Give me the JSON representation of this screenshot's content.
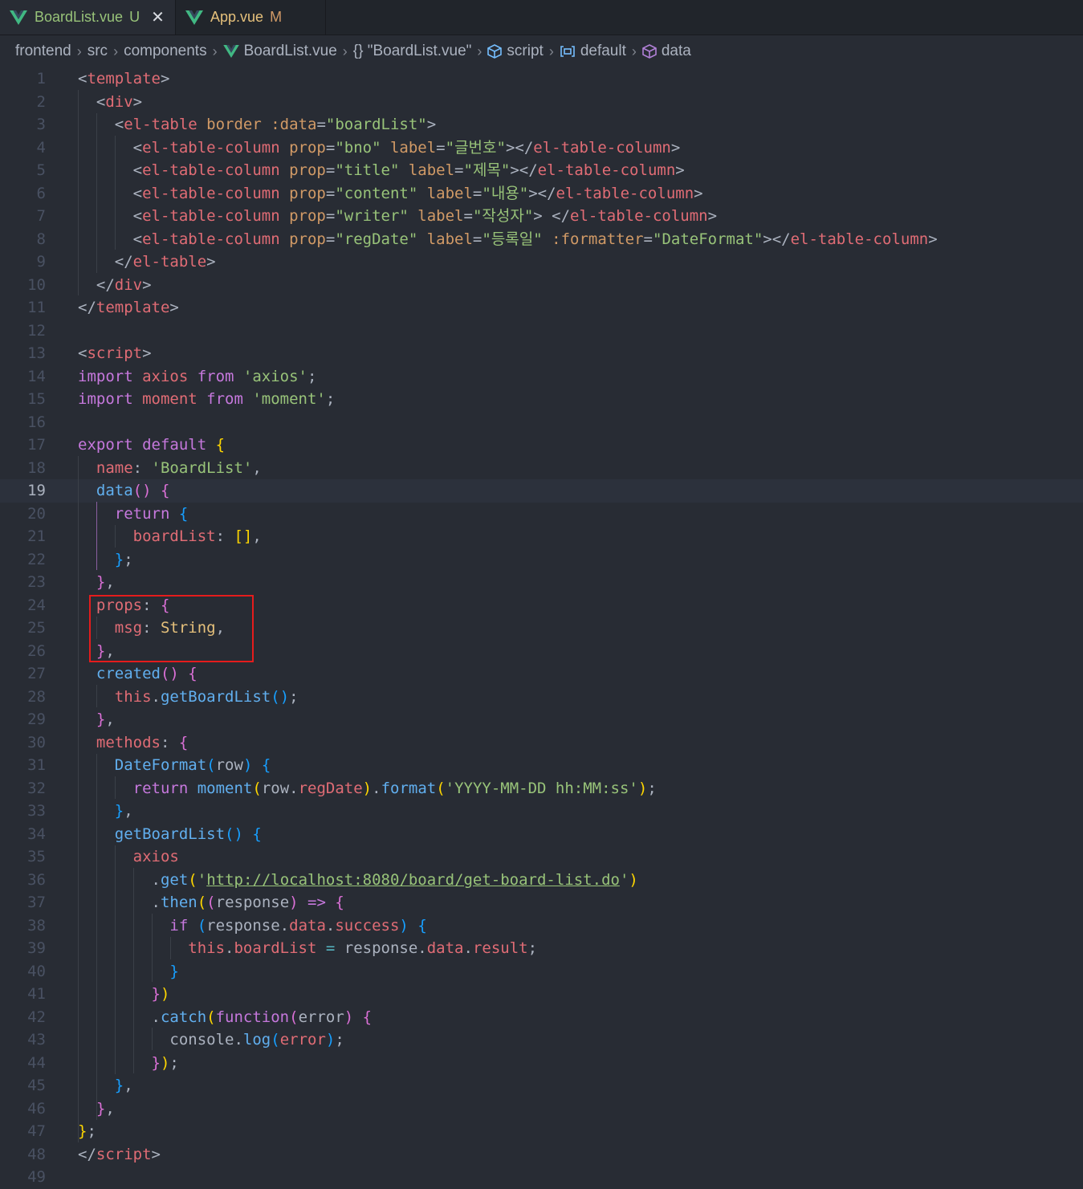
{
  "tabs": [
    {
      "name": "BoardList.vue",
      "status": "U",
      "close": "✕",
      "active": true
    },
    {
      "name": "App.vue",
      "status": "M",
      "active": false
    }
  ],
  "breadcrumb": [
    "frontend",
    "src",
    "components",
    "BoardList.vue",
    "{} \"BoardList.vue\"",
    "script",
    "default",
    "data"
  ],
  "editor": {
    "current_line": 19,
    "lines": [
      [
        [
          "t-punc",
          "<"
        ],
        [
          "t-tag",
          "template"
        ],
        [
          "t-punc",
          ">"
        ]
      ],
      [
        [
          "t-punc",
          "  <"
        ],
        [
          "t-tag",
          "div"
        ],
        [
          "t-punc",
          ">"
        ]
      ],
      [
        [
          "t-punc",
          "    <"
        ],
        [
          "t-tag",
          "el-table"
        ],
        [
          "t-attr",
          " border :data"
        ],
        [
          "t-punc",
          "="
        ],
        [
          "t-str",
          "\"boardList\""
        ],
        [
          "t-punc",
          ">"
        ]
      ],
      [
        [
          "t-punc",
          "      <"
        ],
        [
          "t-tag",
          "el-table-column"
        ],
        [
          "t-attr",
          " prop"
        ],
        [
          "t-punc",
          "="
        ],
        [
          "t-str",
          "\"bno\""
        ],
        [
          "t-attr",
          " label"
        ],
        [
          "t-punc",
          "="
        ],
        [
          "t-str",
          "\"글번호\""
        ],
        [
          "t-punc",
          "></"
        ],
        [
          "t-tag",
          "el-table-column"
        ],
        [
          "t-punc",
          ">"
        ]
      ],
      [
        [
          "t-punc",
          "      <"
        ],
        [
          "t-tag",
          "el-table-column"
        ],
        [
          "t-attr",
          " prop"
        ],
        [
          "t-punc",
          "="
        ],
        [
          "t-str",
          "\"title\""
        ],
        [
          "t-attr",
          " label"
        ],
        [
          "t-punc",
          "="
        ],
        [
          "t-str",
          "\"제목\""
        ],
        [
          "t-punc",
          "></"
        ],
        [
          "t-tag",
          "el-table-column"
        ],
        [
          "t-punc",
          ">"
        ]
      ],
      [
        [
          "t-punc",
          "      <"
        ],
        [
          "t-tag",
          "el-table-column"
        ],
        [
          "t-attr",
          " prop"
        ],
        [
          "t-punc",
          "="
        ],
        [
          "t-str",
          "\"content\""
        ],
        [
          "t-attr",
          " label"
        ],
        [
          "t-punc",
          "="
        ],
        [
          "t-str",
          "\"내용\""
        ],
        [
          "t-punc",
          "></"
        ],
        [
          "t-tag",
          "el-table-column"
        ],
        [
          "t-punc",
          ">"
        ]
      ],
      [
        [
          "t-punc",
          "      <"
        ],
        [
          "t-tag",
          "el-table-column"
        ],
        [
          "t-attr",
          " prop"
        ],
        [
          "t-punc",
          "="
        ],
        [
          "t-str",
          "\"writer\""
        ],
        [
          "t-attr",
          " label"
        ],
        [
          "t-punc",
          "="
        ],
        [
          "t-str",
          "\"작성자\""
        ],
        [
          "t-punc",
          "> </"
        ],
        [
          "t-tag",
          "el-table-column"
        ],
        [
          "t-punc",
          ">"
        ]
      ],
      [
        [
          "t-punc",
          "      <"
        ],
        [
          "t-tag",
          "el-table-column"
        ],
        [
          "t-attr",
          " prop"
        ],
        [
          "t-punc",
          "="
        ],
        [
          "t-str",
          "\"regDate\""
        ],
        [
          "t-attr",
          " label"
        ],
        [
          "t-punc",
          "="
        ],
        [
          "t-str",
          "\"등록일\""
        ],
        [
          "t-attr",
          " :formatter"
        ],
        [
          "t-punc",
          "="
        ],
        [
          "t-str",
          "\"DateFormat\""
        ],
        [
          "t-punc",
          "></"
        ],
        [
          "t-tag",
          "el-table-column"
        ],
        [
          "t-punc",
          ">"
        ]
      ],
      [
        [
          "t-punc",
          "    </"
        ],
        [
          "t-tag",
          "el-table"
        ],
        [
          "t-punc",
          ">"
        ]
      ],
      [
        [
          "t-punc",
          "  </"
        ],
        [
          "t-tag",
          "div"
        ],
        [
          "t-punc",
          ">"
        ]
      ],
      [
        [
          "t-punc",
          "</"
        ],
        [
          "t-tag",
          "template"
        ],
        [
          "t-punc",
          ">"
        ]
      ],
      [],
      [
        [
          "t-punc",
          "<"
        ],
        [
          "t-tag",
          "script"
        ],
        [
          "t-punc",
          ">"
        ]
      ],
      [
        [
          "t-kw",
          "import"
        ],
        [
          "t-var",
          " axios"
        ],
        [
          "t-kw",
          " from"
        ],
        [
          "t-str",
          " 'axios'"
        ],
        [
          "t-punc",
          ";"
        ]
      ],
      [
        [
          "t-kw",
          "import"
        ],
        [
          "t-var",
          " moment"
        ],
        [
          "t-kw",
          " from"
        ],
        [
          "t-str",
          " 'moment'"
        ],
        [
          "t-punc",
          ";"
        ]
      ],
      [],
      [
        [
          "t-kw",
          "export default"
        ],
        [
          "t-b1",
          " {"
        ]
      ],
      [
        [
          "t-var",
          "  name"
        ],
        [
          "t-punc",
          ": "
        ],
        [
          "t-str",
          "'BoardList'"
        ],
        [
          "t-punc",
          ","
        ]
      ],
      [
        [
          "t-fn",
          "  data"
        ],
        [
          "t-b2",
          "()"
        ],
        [
          "t-b2",
          " {"
        ]
      ],
      [
        [
          "t-kw",
          "    return"
        ],
        [
          "t-b3",
          " {"
        ]
      ],
      [
        [
          "t-var",
          "      boardList"
        ],
        [
          "t-punc",
          ": "
        ],
        [
          "t-b1",
          "[]"
        ],
        [
          "t-punc",
          ","
        ]
      ],
      [
        [
          "t-b3",
          "    }"
        ],
        [
          "t-punc",
          ";"
        ]
      ],
      [
        [
          "t-b2",
          "  }"
        ],
        [
          "t-punc",
          ","
        ]
      ],
      [
        [
          "t-var",
          "  props"
        ],
        [
          "t-punc",
          ": "
        ],
        [
          "t-b2",
          "{"
        ]
      ],
      [
        [
          "t-var",
          "    msg"
        ],
        [
          "t-punc",
          ": "
        ],
        [
          "t-type",
          "String"
        ],
        [
          "t-punc",
          ","
        ]
      ],
      [
        [
          "t-b2",
          "  }"
        ],
        [
          "t-punc",
          ","
        ]
      ],
      [
        [
          "t-fn",
          "  created"
        ],
        [
          "t-b2",
          "()"
        ],
        [
          "t-b2",
          " {"
        ]
      ],
      [
        [
          "t-var",
          "    this"
        ],
        [
          "t-punc",
          "."
        ],
        [
          "t-fn",
          "getBoardList"
        ],
        [
          "t-b3",
          "()"
        ],
        [
          "t-punc",
          ";"
        ]
      ],
      [
        [
          "t-b2",
          "  }"
        ],
        [
          "t-punc",
          ","
        ]
      ],
      [
        [
          "t-var",
          "  methods"
        ],
        [
          "t-punc",
          ": "
        ],
        [
          "t-b2",
          "{"
        ]
      ],
      [
        [
          "t-fn",
          "    DateFormat"
        ],
        [
          "t-b3",
          "("
        ],
        [
          "t-punc",
          "row"
        ],
        [
          "t-b3",
          ")"
        ],
        [
          "t-b3",
          " {"
        ]
      ],
      [
        [
          "t-kw",
          "      return"
        ],
        [
          "t-fn",
          " moment"
        ],
        [
          "t-b1",
          "("
        ],
        [
          "t-punc",
          "row."
        ],
        [
          "t-var",
          "regDate"
        ],
        [
          "t-b1",
          ")"
        ],
        [
          "t-punc",
          "."
        ],
        [
          "t-fn",
          "format"
        ],
        [
          "t-b1",
          "("
        ],
        [
          "t-str",
          "'YYYY-MM-DD hh:MM:ss'"
        ],
        [
          "t-b1",
          ")"
        ],
        [
          "t-punc",
          ";"
        ]
      ],
      [
        [
          "t-b3",
          "    }"
        ],
        [
          "t-punc",
          ","
        ]
      ],
      [
        [
          "t-fn",
          "    getBoardList"
        ],
        [
          "t-b3",
          "()"
        ],
        [
          "t-b3",
          " {"
        ]
      ],
      [
        [
          "t-var",
          "      axios"
        ]
      ],
      [
        [
          "t-punc",
          "        ."
        ],
        [
          "t-fn",
          "get"
        ],
        [
          "t-b1",
          "("
        ],
        [
          "t-str",
          "'"
        ],
        [
          "t-url",
          "http://localhost:8080/board/get-board-list.do"
        ],
        [
          "t-str",
          "'"
        ],
        [
          "t-b1",
          ")"
        ]
      ],
      [
        [
          "t-punc",
          "        ."
        ],
        [
          "t-fn",
          "then"
        ],
        [
          "t-b1",
          "("
        ],
        [
          "t-b2",
          "("
        ],
        [
          "t-punc",
          "response"
        ],
        [
          "t-b2",
          ")"
        ],
        [
          "t-kw",
          " =>"
        ],
        [
          "t-b2",
          " {"
        ]
      ],
      [
        [
          "t-kw",
          "          if"
        ],
        [
          "t-b3",
          " ("
        ],
        [
          "t-punc",
          "response."
        ],
        [
          "t-var",
          "data"
        ],
        [
          "t-punc",
          "."
        ],
        [
          "t-var",
          "success"
        ],
        [
          "t-b3",
          ")"
        ],
        [
          "t-b3",
          " {"
        ]
      ],
      [
        [
          "t-var",
          "            this"
        ],
        [
          "t-punc",
          "."
        ],
        [
          "t-var",
          "boardList"
        ],
        [
          "t-op",
          " ="
        ],
        [
          "t-punc",
          " response."
        ],
        [
          "t-var",
          "data"
        ],
        [
          "t-punc",
          "."
        ],
        [
          "t-var",
          "result"
        ],
        [
          "t-punc",
          ";"
        ]
      ],
      [
        [
          "t-b3",
          "          }"
        ]
      ],
      [
        [
          "t-b2",
          "        }"
        ],
        [
          "t-b1",
          ")"
        ]
      ],
      [
        [
          "t-punc",
          "        ."
        ],
        [
          "t-fn",
          "catch"
        ],
        [
          "t-b1",
          "("
        ],
        [
          "t-kw",
          "function"
        ],
        [
          "t-b2",
          "("
        ],
        [
          "t-punc",
          "error"
        ],
        [
          "t-b2",
          ")"
        ],
        [
          "t-b2",
          " {"
        ]
      ],
      [
        [
          "t-punc",
          "          console."
        ],
        [
          "t-fn",
          "log"
        ],
        [
          "t-b3",
          "("
        ],
        [
          "t-var",
          "error"
        ],
        [
          "t-b3",
          ")"
        ],
        [
          "t-punc",
          ";"
        ]
      ],
      [
        [
          "t-b2",
          "        }"
        ],
        [
          "t-b1",
          ")"
        ],
        [
          "t-punc",
          ";"
        ]
      ],
      [
        [
          "t-b3",
          "    }"
        ],
        [
          "t-punc",
          ","
        ]
      ],
      [
        [
          "t-b2",
          "  }"
        ],
        [
          "t-punc",
          ","
        ]
      ],
      [
        [
          "t-b1",
          "}"
        ],
        [
          "t-punc",
          ";"
        ]
      ],
      [
        [
          "t-punc",
          "</"
        ],
        [
          "t-tag",
          "script"
        ],
        [
          "t-punc",
          ">"
        ]
      ],
      []
    ]
  }
}
